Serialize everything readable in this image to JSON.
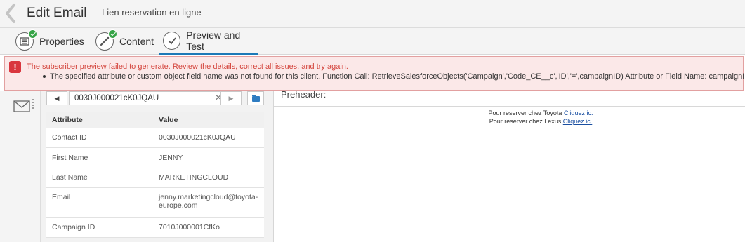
{
  "header": {
    "title": "Edit Email",
    "subtitle": "Lien reservation en ligne"
  },
  "tabs": [
    {
      "label": "Properties",
      "icon": "properties-icon",
      "status": "complete"
    },
    {
      "label": "Content",
      "icon": "content-icon",
      "status": "complete"
    },
    {
      "label": "Preview and Test",
      "icon": "checkmark-icon",
      "active": true
    }
  ],
  "alert": {
    "title": "The subscriber preview failed to generate. Review the details, correct all issues, and try again.",
    "detail": "The specified attribute or custom object field name was not found for this client. Function Call: RetrieveSalesforceObjects('Campaign','Code_CE__c','ID','=',campaignID) Attribute or Field Name: campaignID"
  },
  "subscriber": {
    "id": "0030J000021cK0JQAU",
    "columns": {
      "attribute": "Attribute",
      "value": "Value"
    },
    "rows": [
      {
        "attribute": "Contact ID",
        "value": "0030J000021cK0JQAU"
      },
      {
        "attribute": "First Name",
        "value": "JENNY"
      },
      {
        "attribute": "Last Name",
        "value": "MARKETINGCLOUD"
      },
      {
        "attribute": "Email",
        "value": "jenny.marketingcloud@toyota-europe.com"
      },
      {
        "attribute": "Campaign ID",
        "value": "7010J000001CfKo"
      }
    ]
  },
  "preview": {
    "preheader": "Preheader:",
    "lines": [
      {
        "text": "Pour reserver chez Toyota",
        "link": "Cliquez ic."
      },
      {
        "text": "Pour reserver chez Lexus",
        "link": "Cliquez ic."
      }
    ]
  },
  "colors": {
    "accent": "#1b79b7",
    "success": "#37a447",
    "error": "#d9363e",
    "alert_bg": "#fbe8e8",
    "link": "#1a4fa1"
  }
}
